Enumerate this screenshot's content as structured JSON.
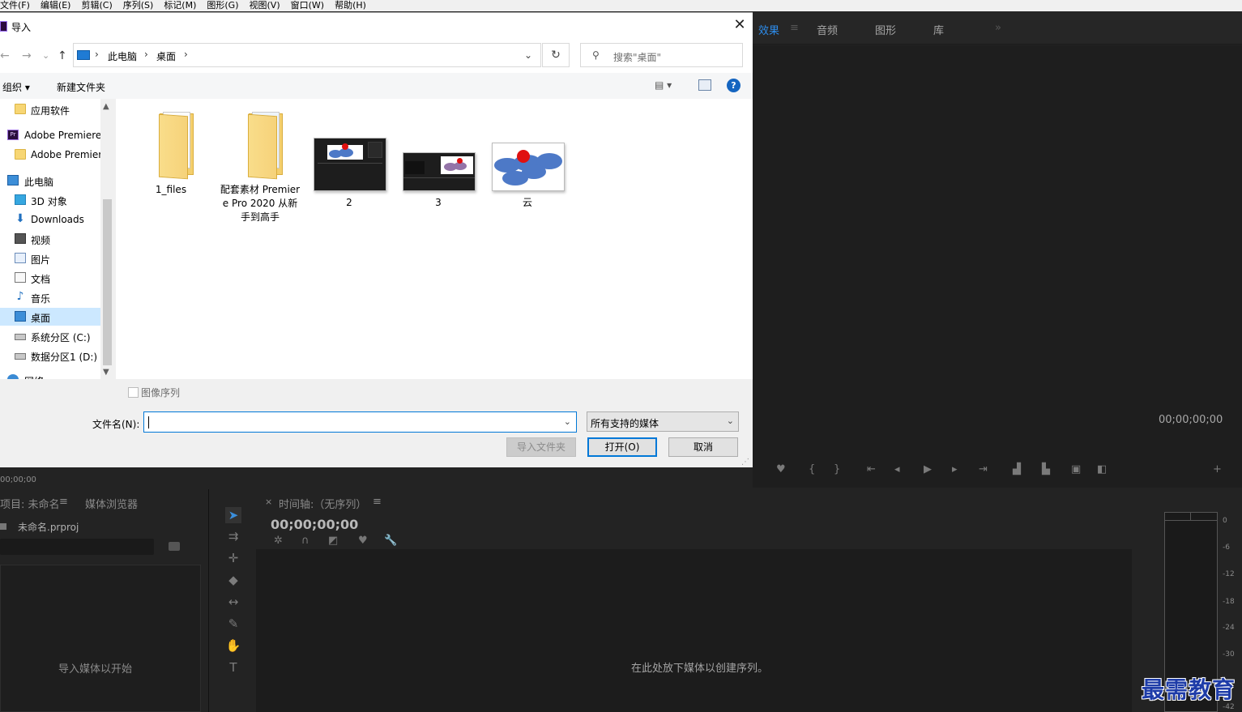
{
  "menubar": {
    "items": [
      "文件(F)",
      "编辑(E)",
      "剪辑(C)",
      "序列(S)",
      "标记(M)",
      "图形(G)",
      "视图(V)",
      "窗口(W)",
      "帮助(H)"
    ]
  },
  "effects_panel": {
    "tabs": [
      "效果",
      "音频",
      "图形",
      "库"
    ],
    "active_tab": "效果",
    "overflow": "»",
    "menu": "≡"
  },
  "program_monitor": {
    "timecode": "00;00;00;00"
  },
  "source_monitor": {
    "timecode": "00;00;00"
  },
  "project_panel": {
    "title": "项目: 未命名",
    "menu": "≡",
    "media_browser_tab": "媒体浏览器",
    "file": "未命名.prproj",
    "empty_text": "导入媒体以开始"
  },
  "timeline_panel": {
    "close": "×",
    "title": "时间轴:（无序列）",
    "menu": "≡",
    "timecode": "00;00;00;00",
    "empty_text": "在此处放下媒体以创建序列。"
  },
  "audio_meter": {
    "labels": [
      "0",
      "-6",
      "-12",
      "-18",
      "-24",
      "-30",
      "-42"
    ]
  },
  "watermark": {
    "text": "最需教育"
  },
  "dialog": {
    "title": "导入",
    "close": "✕",
    "nav": {
      "back": "←",
      "forward": "→",
      "recent": "⌄",
      "up": "↑"
    },
    "address": {
      "crumbs": [
        "此电脑",
        "桌面"
      ],
      "sep": "›",
      "dropdown": "⌄",
      "refresh": "↻"
    },
    "search": {
      "icon": "⚲",
      "placeholder": "搜索\"桌面\""
    },
    "toolbar": {
      "organize": "组织 ▾",
      "new_folder": "新建文件夹",
      "view": "▤ ▾",
      "help": "?"
    },
    "nav_pane": {
      "scroll_up": "▲",
      "scroll_down": "▼",
      "items": [
        {
          "label": "应用软件",
          "icon": "folder-icon"
        },
        {
          "label": "Adobe Premiere Pro",
          "icon": "premiere-icon"
        },
        {
          "label": "Adobe Premiere Pro",
          "icon": "folder-icon"
        },
        {
          "label": "此电脑",
          "icon": "pc-icon"
        },
        {
          "label": "3D 对象",
          "icon": "cube-icon"
        },
        {
          "label": "Downloads",
          "icon": "download-icon"
        },
        {
          "label": "视频",
          "icon": "video-icon"
        },
        {
          "label": "图片",
          "icon": "picture-icon"
        },
        {
          "label": "文档",
          "icon": "document-icon"
        },
        {
          "label": "音乐",
          "icon": "music-icon"
        },
        {
          "label": "桌面",
          "icon": "desktop-icon"
        },
        {
          "label": "系统分区 (C:)",
          "icon": "drive-icon"
        },
        {
          "label": "数据分区1 (D:)",
          "icon": "drive-icon"
        },
        {
          "label": "网络",
          "icon": "network-icon"
        }
      ]
    },
    "files": [
      {
        "name": "1_files",
        "type": "folder"
      },
      {
        "name": "配套素材 Premiere Pro 2020 从新手到高手",
        "type": "folder"
      },
      {
        "name": "2",
        "type": "image"
      },
      {
        "name": "3",
        "type": "image"
      },
      {
        "name": "云",
        "type": "image"
      }
    ],
    "image_sequence_label": "图像序列",
    "filename_label": "文件名(N):",
    "filename_value": "",
    "filetype_value": "所有支持的媒体",
    "dropdown_glyph": "⌄",
    "buttons": {
      "import_folder": "导入文件夹",
      "open": "打开(O)",
      "cancel": "取消"
    }
  },
  "colors": {
    "accent": "#0078d7",
    "premiere_bg": "#232323",
    "premiere_active": "#2d8ceb"
  }
}
